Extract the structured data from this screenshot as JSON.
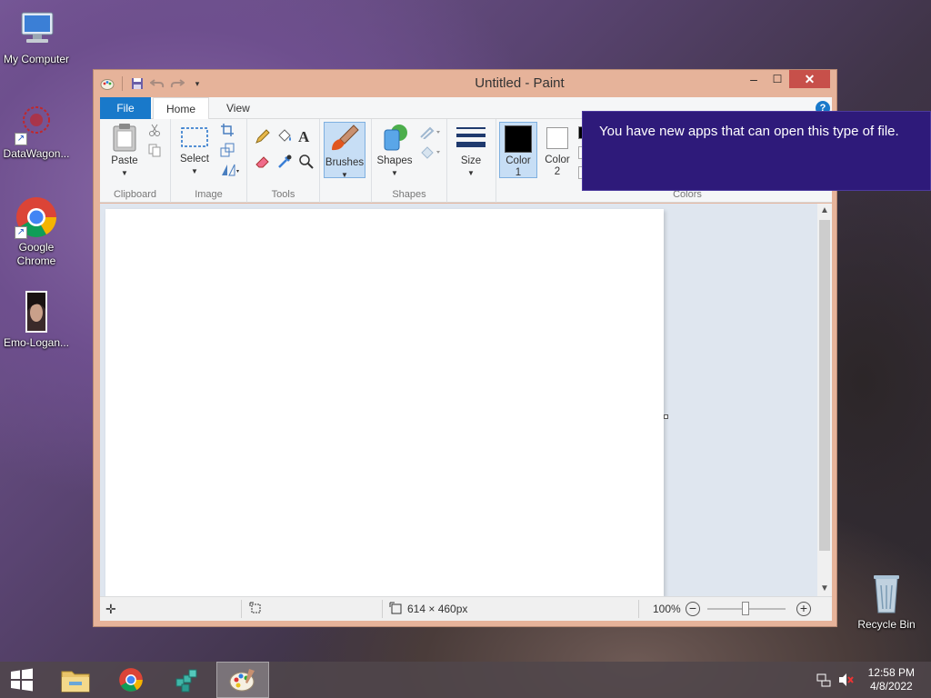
{
  "desktop": {
    "icons": [
      {
        "label": "My Computer"
      },
      {
        "label": "DataWagon..."
      },
      {
        "label": "Google Chrome"
      },
      {
        "label": "Emo-Logan..."
      },
      {
        "label": "Recycle Bin"
      }
    ]
  },
  "window": {
    "title": "Untitled - Paint",
    "controls": {
      "minimize": "–",
      "maximize": "☐",
      "close": "✕"
    }
  },
  "ribbon": {
    "tabs": [
      {
        "label": "File"
      },
      {
        "label": "Home"
      },
      {
        "label": "View"
      }
    ],
    "groups": {
      "clipboard": {
        "label": "Clipboard",
        "paste": "Paste"
      },
      "image": {
        "label": "Image",
        "select": "Select"
      },
      "tools": {
        "label": "Tools"
      },
      "brushes": {
        "label": "Brushes"
      },
      "shapes": {
        "label": "Shapes",
        "shapes_btn": "Shapes"
      },
      "size": {
        "label": "Size"
      },
      "colors": {
        "label": "Colors",
        "color1_a": "Color",
        "color1_b": "1",
        "color2_a": "Color",
        "color2_b": "2"
      }
    }
  },
  "status": {
    "dimensions": "614 × 460px",
    "zoom": "100%"
  },
  "notification": {
    "text": "You have new apps that can open this type of file."
  },
  "taskbar": {
    "time": "12:58 PM",
    "date": "4/8/2022"
  },
  "colors": {
    "file_tab": "#1979ca",
    "toast_bg": "#2e1a7a",
    "window_frame": "#e6b39a",
    "close_button": "#c7504a",
    "color1": "#000000",
    "color2": "#ffffff"
  }
}
